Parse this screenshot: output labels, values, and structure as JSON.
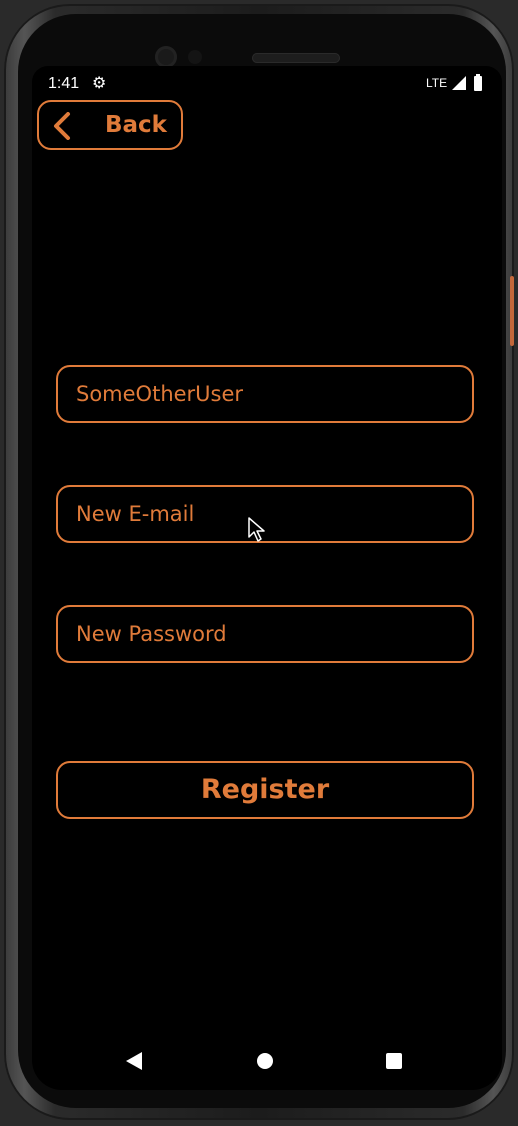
{
  "status_bar": {
    "time": "1:41",
    "network": "LTE",
    "gear_icon": "gear-icon",
    "signal_icon": "signal-icon",
    "battery_icon": "battery-icon"
  },
  "header": {
    "back_label": "Back",
    "back_icon": "chevron-left-icon"
  },
  "form": {
    "username_value": "SomeOtherUser",
    "email_placeholder": "New E-mail",
    "password_placeholder": "New Password",
    "register_label": "Register"
  },
  "nav_bar": {
    "back_icon": "triangle-back-icon",
    "home_icon": "circle-home-icon",
    "recents_icon": "square-recents-icon"
  },
  "colors": {
    "accent": "#e07b3a",
    "background": "#000000"
  }
}
